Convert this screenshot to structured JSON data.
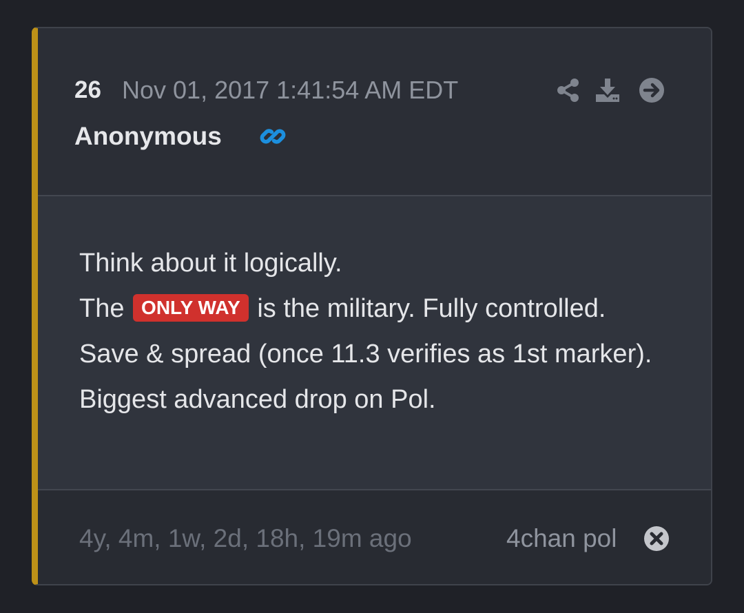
{
  "post": {
    "number": "26",
    "timestamp": "Nov 01, 2017 1:41:54 AM EDT",
    "author": "Anonymous",
    "accent_color": "#bd9118",
    "tag_color": "#d0312d",
    "icons": {
      "author_link": "link-icon",
      "share": "share-icon",
      "download": "download-icon",
      "open": "arrow-right-circle-icon",
      "dismiss": "close-circle-icon"
    },
    "body": {
      "line1": "Think about it logically.",
      "line2_prefix": "The",
      "line2_tag": "ONLY WAY",
      "line2_suffix": "is the military. Fully controlled.",
      "line3": "Save & spread (once 11.3 verifies as 1st marker).",
      "line4": "Biggest advanced drop on Pol."
    },
    "footer": {
      "elapsed": "4y, 4m, 1w, 2d, 18h, 19m ago",
      "source": "4chan pol"
    }
  }
}
